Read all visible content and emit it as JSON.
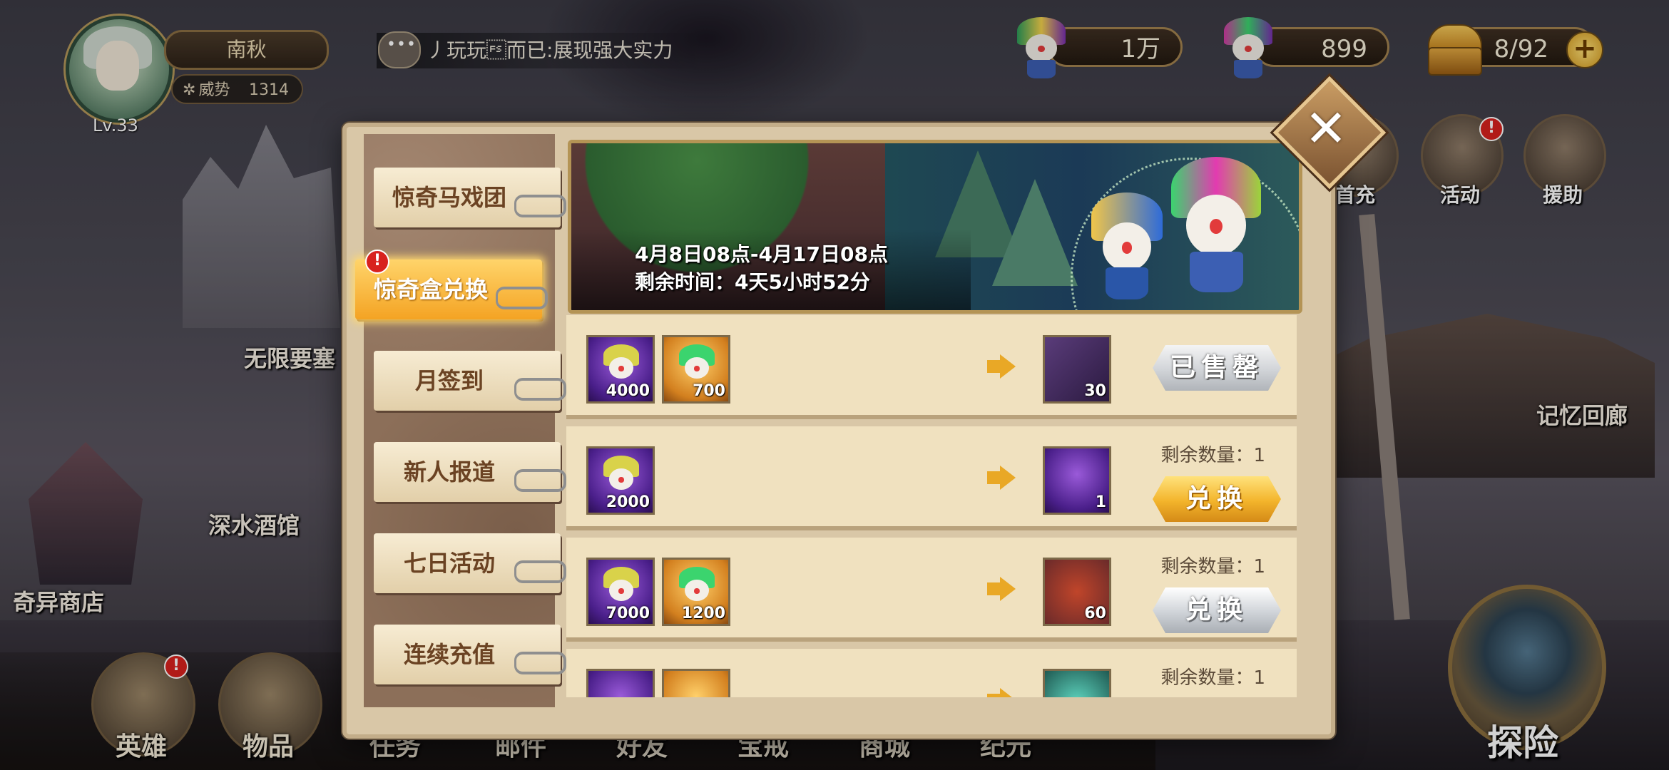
{
  "player": {
    "name": "南秋",
    "level": "Lv.33",
    "power_label": "威势",
    "power_value": "1314"
  },
  "chat": {
    "message": "丿玩玩\u001c而已:展现强大实力"
  },
  "resources": [
    {
      "name": "clown-token-a",
      "value": "1万"
    },
    {
      "name": "clown-token-b",
      "value": "899"
    },
    {
      "name": "stamina",
      "value": "8/92"
    }
  ],
  "side_menu": [
    {
      "label": "首充",
      "alert": false
    },
    {
      "label": "活动",
      "alert": true
    },
    {
      "label": "援助",
      "alert": false
    }
  ],
  "places": {
    "fortress": "无限要塞",
    "tavern": "深水酒馆",
    "shop": "奇异商店",
    "gallery": "记忆回廊"
  },
  "bottom_nav": [
    "英雄",
    "物品",
    "任务",
    "邮件",
    "好友",
    "宝戒",
    "商城",
    "纪元"
  ],
  "explore": "探险",
  "alert_mark": "!",
  "modal": {
    "tabs": [
      {
        "label": "惊奇马戏团",
        "active": false
      },
      {
        "label": "惊奇盒兑换",
        "active": true,
        "alert": true
      },
      {
        "label": "月签到",
        "active": false
      },
      {
        "label": "新人报道",
        "active": false
      },
      {
        "label": "七日活动",
        "active": false
      },
      {
        "label": "连续充值",
        "active": false
      }
    ],
    "banner": {
      "dates": "4月8日08点-4月17日08点",
      "remaining": "剩余时间：4天5小时52分"
    },
    "close": "✕",
    "rows": [
      {
        "costs": [
          {
            "type": "purple",
            "qty": "4000"
          },
          {
            "type": "orange",
            "qty": "700"
          }
        ],
        "reward": {
          "qty": "30",
          "color": "#4a2e6a"
        },
        "remain": "",
        "button": "已售罄",
        "button_style": "soldout"
      },
      {
        "costs": [
          {
            "type": "purple",
            "qty": "2000"
          }
        ],
        "reward": {
          "qty": "1",
          "color": "#5a2f8a"
        },
        "remain": "剩余数量：1",
        "button": "兑换",
        "button_style": "gold"
      },
      {
        "costs": [
          {
            "type": "purple",
            "qty": "7000"
          },
          {
            "type": "orange",
            "qty": "1200"
          }
        ],
        "reward": {
          "qty": "60",
          "color": "#6a2a2a"
        },
        "remain": "剩余数量：1",
        "button": "兑换",
        "button_style": "silver"
      },
      {
        "costs": [
          {
            "type": "purple",
            "qty": ""
          },
          {
            "type": "orange",
            "qty": ""
          }
        ],
        "reward": {
          "qty": "",
          "color": "#1f5a52"
        },
        "remain": "剩余数量：1",
        "button": "",
        "button_style": "none"
      }
    ]
  }
}
